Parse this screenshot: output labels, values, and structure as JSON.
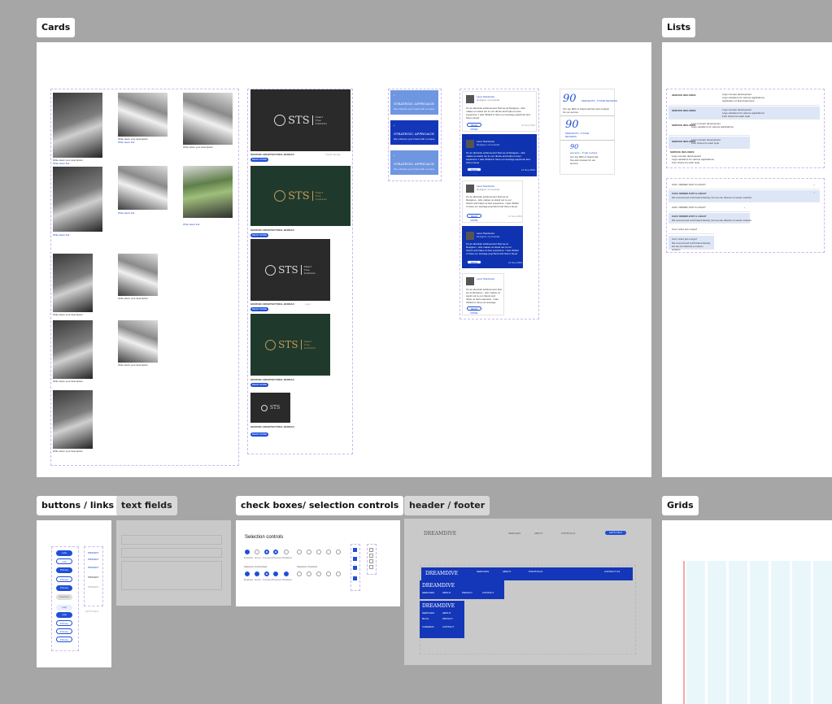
{
  "frames": {
    "cards": "Cards",
    "lists": "Lists",
    "buttons": "buttons / links",
    "text_fields": "text fields",
    "check_boxes": "check boxes/ selection controls",
    "header_footer": "header / footer",
    "grids": "Grids"
  },
  "cards": {
    "photo_caption_title": "Write down your description",
    "photo_caption_link": "Write down link",
    "photo_caption_date": "22 Oct 2023",
    "sts_brand": "STS",
    "sts_tagline_1": "Smart",
    "sts_tagline_2": "Tree",
    "sts_tagline_3": "Solutions",
    "sts_caption": "GRAPHIC ARCHITECTURAL BUREAU",
    "sts_tag_1": "Logo",
    "sts_tag_2": "Visual Identity",
    "sts_button": "READ MORE",
    "approach_title": "STRATEGIC APPROACH",
    "approach_text": "We enhance your brand with a unique",
    "testimonial_name": "Lana Tkachenko",
    "testimonial_role": "Designer, Co-founder",
    "testimonial_text": "It's an absolute achievement that we at Designer-- who makes us stand out to our clients and helps us feel expensive. I was thrilled to have our average paycheck and help a buyer",
    "testimonial_button": "READ MORE",
    "testimonial_date": "12 Sep 2023",
    "stat_number": "90",
    "stat_label": "PERCENTS - 5 STAR REVIEWS",
    "stat_label_2": "PERCENTS - 5 STAR REVIEWS",
    "stat_label_3": "percents – 5 star reviews",
    "stat_text": "Our top 90% of clients left five-star reviews for our service"
  },
  "lists": {
    "service_title": "SERVICE INCLUDES:",
    "service_title_short": "SERVICE INCLUDES",
    "service_items": [
      "Logo concept development",
      "Logo variations for various applications",
      "Font choice for each style",
      "Application of brand elements"
    ],
    "faq_question": "CAN I ORDER JUST A LOGO?",
    "faq_question_lower": "Can I order just a logo?",
    "faq_answer": "We recommend a full brand identity, but we can discuss a custom solution."
  },
  "selection": {
    "title": "Selection controls",
    "section_1": "Selection Unchecked",
    "section_2": "Selection Checked",
    "labels": [
      "Enabled",
      "Hover",
      "Focused",
      "Pressed",
      "Disabled"
    ]
  },
  "header": {
    "brand": "DREAMDIVE",
    "nav": [
      "SERVICES",
      "ABOUT",
      "PORTFOLIO",
      "CONTACT US",
      "BLOG",
      "PRIVACY",
      "CAREERS",
      "CONTACT"
    ],
    "cta": "LET'S TALK"
  },
  "buttons": {
    "labels": [
      "Link",
      "Link",
      "Primary",
      "Primary",
      "Primary",
      "Disabled"
    ],
    "links": [
      "PRIMARY",
      "PRIMARY",
      "PRIMARY",
      "PRIMARY",
      "PRIMARY"
    ],
    "small": "LET'S TALK"
  }
}
